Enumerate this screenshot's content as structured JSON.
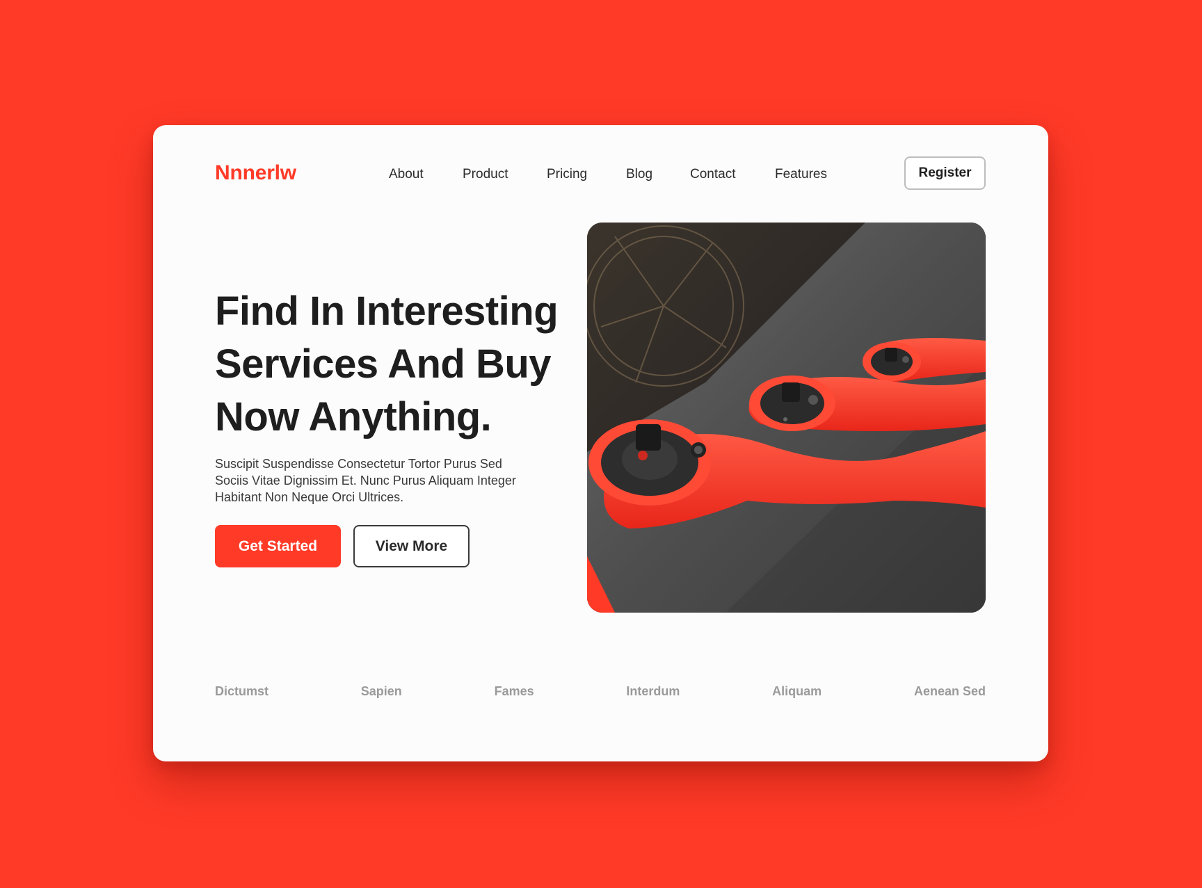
{
  "brand": {
    "name": "Nnnerlw",
    "accent_color": "#ff3a27"
  },
  "nav": {
    "items": [
      "About",
      "Product",
      "Pricing",
      "Blog",
      "Contact",
      "Features"
    ],
    "register_label": "Register"
  },
  "hero": {
    "headline_lines": [
      "Find In Interesting",
      "Services And Buy",
      "Now Anything."
    ],
    "subtext_lines": [
      "Suscipit Suspendisse Consectetur Tortor Purus Sed",
      "Sociis Vitae Dignissim Et. Nunc Purus Aliquam Integer",
      "Habitant Non Neque Orci Ultrices."
    ],
    "primary_button": "Get Started",
    "secondary_button": "View More",
    "image_subject": "red ratchet wrenches on dark fabric"
  },
  "logo_strip": [
    "Dictumst",
    "Sapien",
    "Fames",
    "Interdum",
    "Aliquam",
    "Aenean Sed"
  ]
}
